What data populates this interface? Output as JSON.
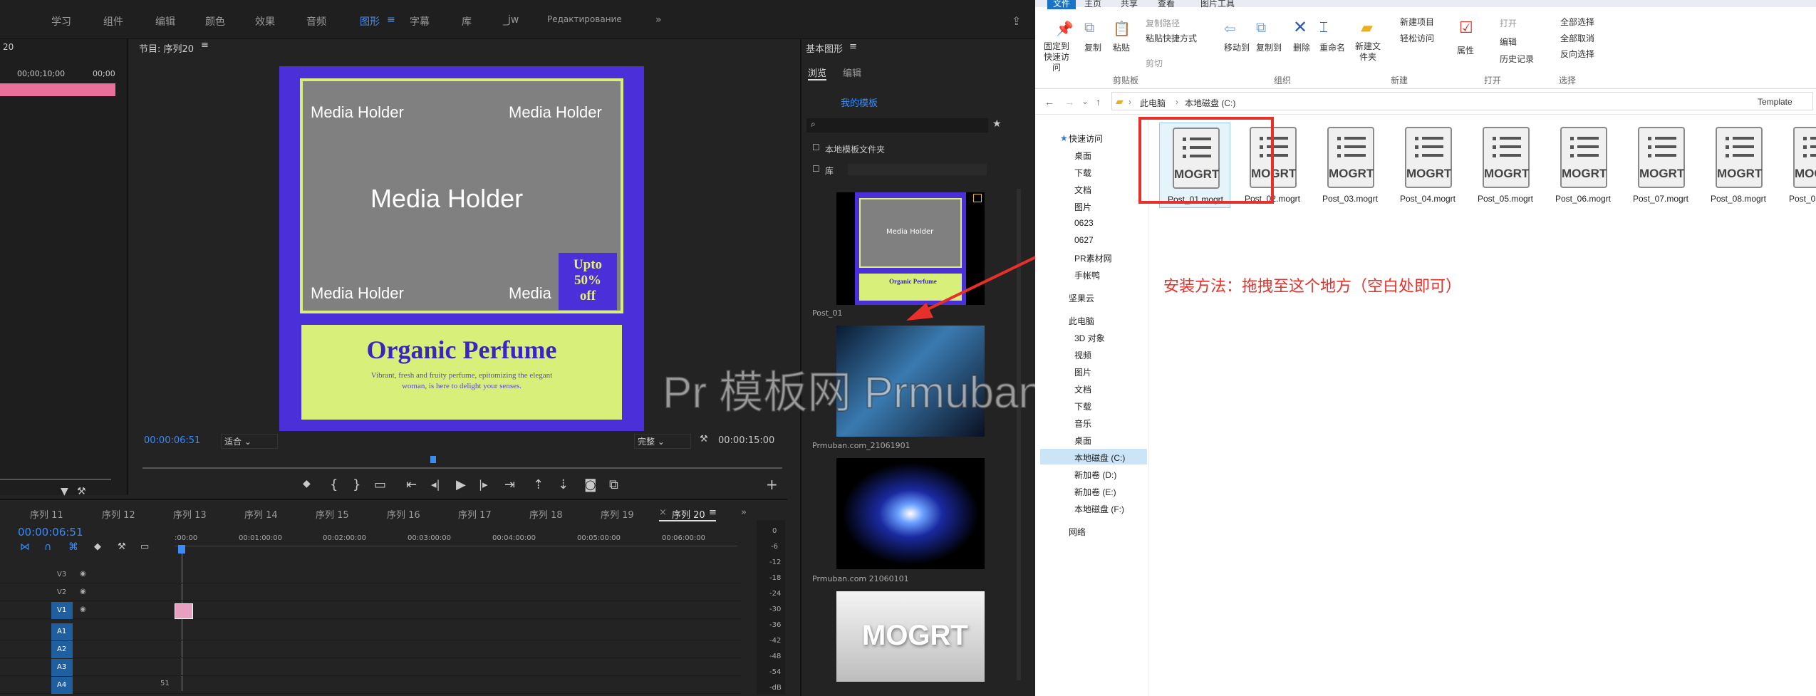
{
  "workspaces": [
    "学习",
    "组件",
    "编辑",
    "颜色",
    "效果",
    "音频",
    "图形",
    "字幕",
    "库",
    "_jw",
    "Редактирование"
  ],
  "workspace_active": "图形",
  "source_panel": {
    "frag": "20",
    "time": "00;00;10;00",
    "time2": "00;00"
  },
  "program": {
    "title": "节目: 序列20",
    "timecode": "00:00:06:51",
    "fit": "适合",
    "quality": "完整",
    "duration": "00:00:15:00"
  },
  "mogrt_preview": {
    "mh_tl": "Media Holder",
    "mh_tr": "Media Holder",
    "mh_center": "Media Holder",
    "mh_bl": "Media Holder",
    "mh_br": "Media",
    "offer": [
      "Upto",
      "50%",
      "off"
    ],
    "title": "Organic Perfume",
    "subtitle": "Vibrant, fresh and fruity perfume, epitomizing the elegant woman, is here to delight your senses.",
    "colors": {
      "frame": "#4b2fd8",
      "accent": "#d8f07a",
      "holder": "#808080"
    }
  },
  "timeline": {
    "tabs": [
      "序列 11",
      "序列 12",
      "序列 13",
      "序列 14",
      "序列 15",
      "序列 16",
      "序列 17",
      "序列 18",
      "序列 19",
      "序列 20"
    ],
    "active_tab": "序列 20",
    "timecode": "00:00:06:51",
    "ruler": [
      ":00:00",
      "00:01:00:00",
      "00:02:00:00",
      "00:03:00:00",
      "00:04:00:00",
      "00:05:00:00",
      "00:06:00:00"
    ],
    "tracks": [
      "V3",
      "V2",
      "V1",
      "A1",
      "A2",
      "A3",
      "A4"
    ],
    "meter": [
      "0",
      "-6",
      "-12",
      "-18",
      "-24",
      "-30",
      "-36",
      "-42",
      "-48",
      "-54",
      "-dB"
    ],
    "bottom_num": "51"
  },
  "essential_graphics": {
    "title": "基本图形",
    "tabs": [
      "浏览",
      "编辑"
    ],
    "my_templates": "我的模板",
    "local_folder": "本地模板文件夹",
    "library": "库",
    "items": [
      {
        "caption": "Post_01"
      },
      {
        "caption": "Prmuban.com_21061901"
      },
      {
        "caption": "Prmuban.com 21060101"
      },
      {
        "caption": "",
        "thumb_text": "MOGRT"
      }
    ]
  },
  "explorer": {
    "ribbon_tabs": [
      "文件",
      "主页",
      "共享",
      "查看",
      "图片工具"
    ],
    "ribbon": {
      "pin": "固定到快速访问",
      "copy": "复制",
      "paste": "粘贴",
      "copy_path": "复制路径",
      "paste_shortcut": "粘贴快捷方式",
      "cut": "剪切",
      "move_to": "移动到",
      "copy_to": "复制到",
      "delete": "删除",
      "rename": "重命名",
      "new_folder": "新建文件夹",
      "new_item": "新建项目",
      "easy_access": "轻松访问",
      "properties": "属性",
      "open": "打开",
      "edit": "编辑",
      "history": "历史记录",
      "select_all": "全部选择",
      "select_none": "全部取消",
      "invert": "反向选择",
      "groups": [
        "剪贴板",
        "组织",
        "新建",
        "打开",
        "选择"
      ]
    },
    "breadcrumb": [
      "此电脑",
      "本地磁盘 (C:)"
    ],
    "folder": "Template",
    "nav": [
      "快速访问",
      "桌面",
      "下载",
      "文档",
      "图片",
      "0623",
      "0627",
      "PR素材网",
      "手帐鸭",
      "坚果云",
      "此电脑",
      "3D 对象",
      "视频",
      "图片",
      "文档",
      "下载",
      "音乐",
      "桌面",
      "本地磁盘 (C:)",
      "新加卷 (D:)",
      "新加卷 (E:)",
      "本地磁盘 (F:)",
      "网络"
    ],
    "files": [
      "Post_01.mogrt",
      "Post_02.mogrt",
      "Post_03.mogrt",
      "Post_04.mogrt",
      "Post_05.mogrt",
      "Post_06.mogrt",
      "Post_07.mogrt",
      "Post_08.mogrt",
      "Post_0"
    ],
    "file_icon_text": "MOGRT"
  },
  "annotation": "安装方法：拖拽至这个地方（空白处即可）",
  "watermark": "Pr 模板网 Prmuban.com"
}
